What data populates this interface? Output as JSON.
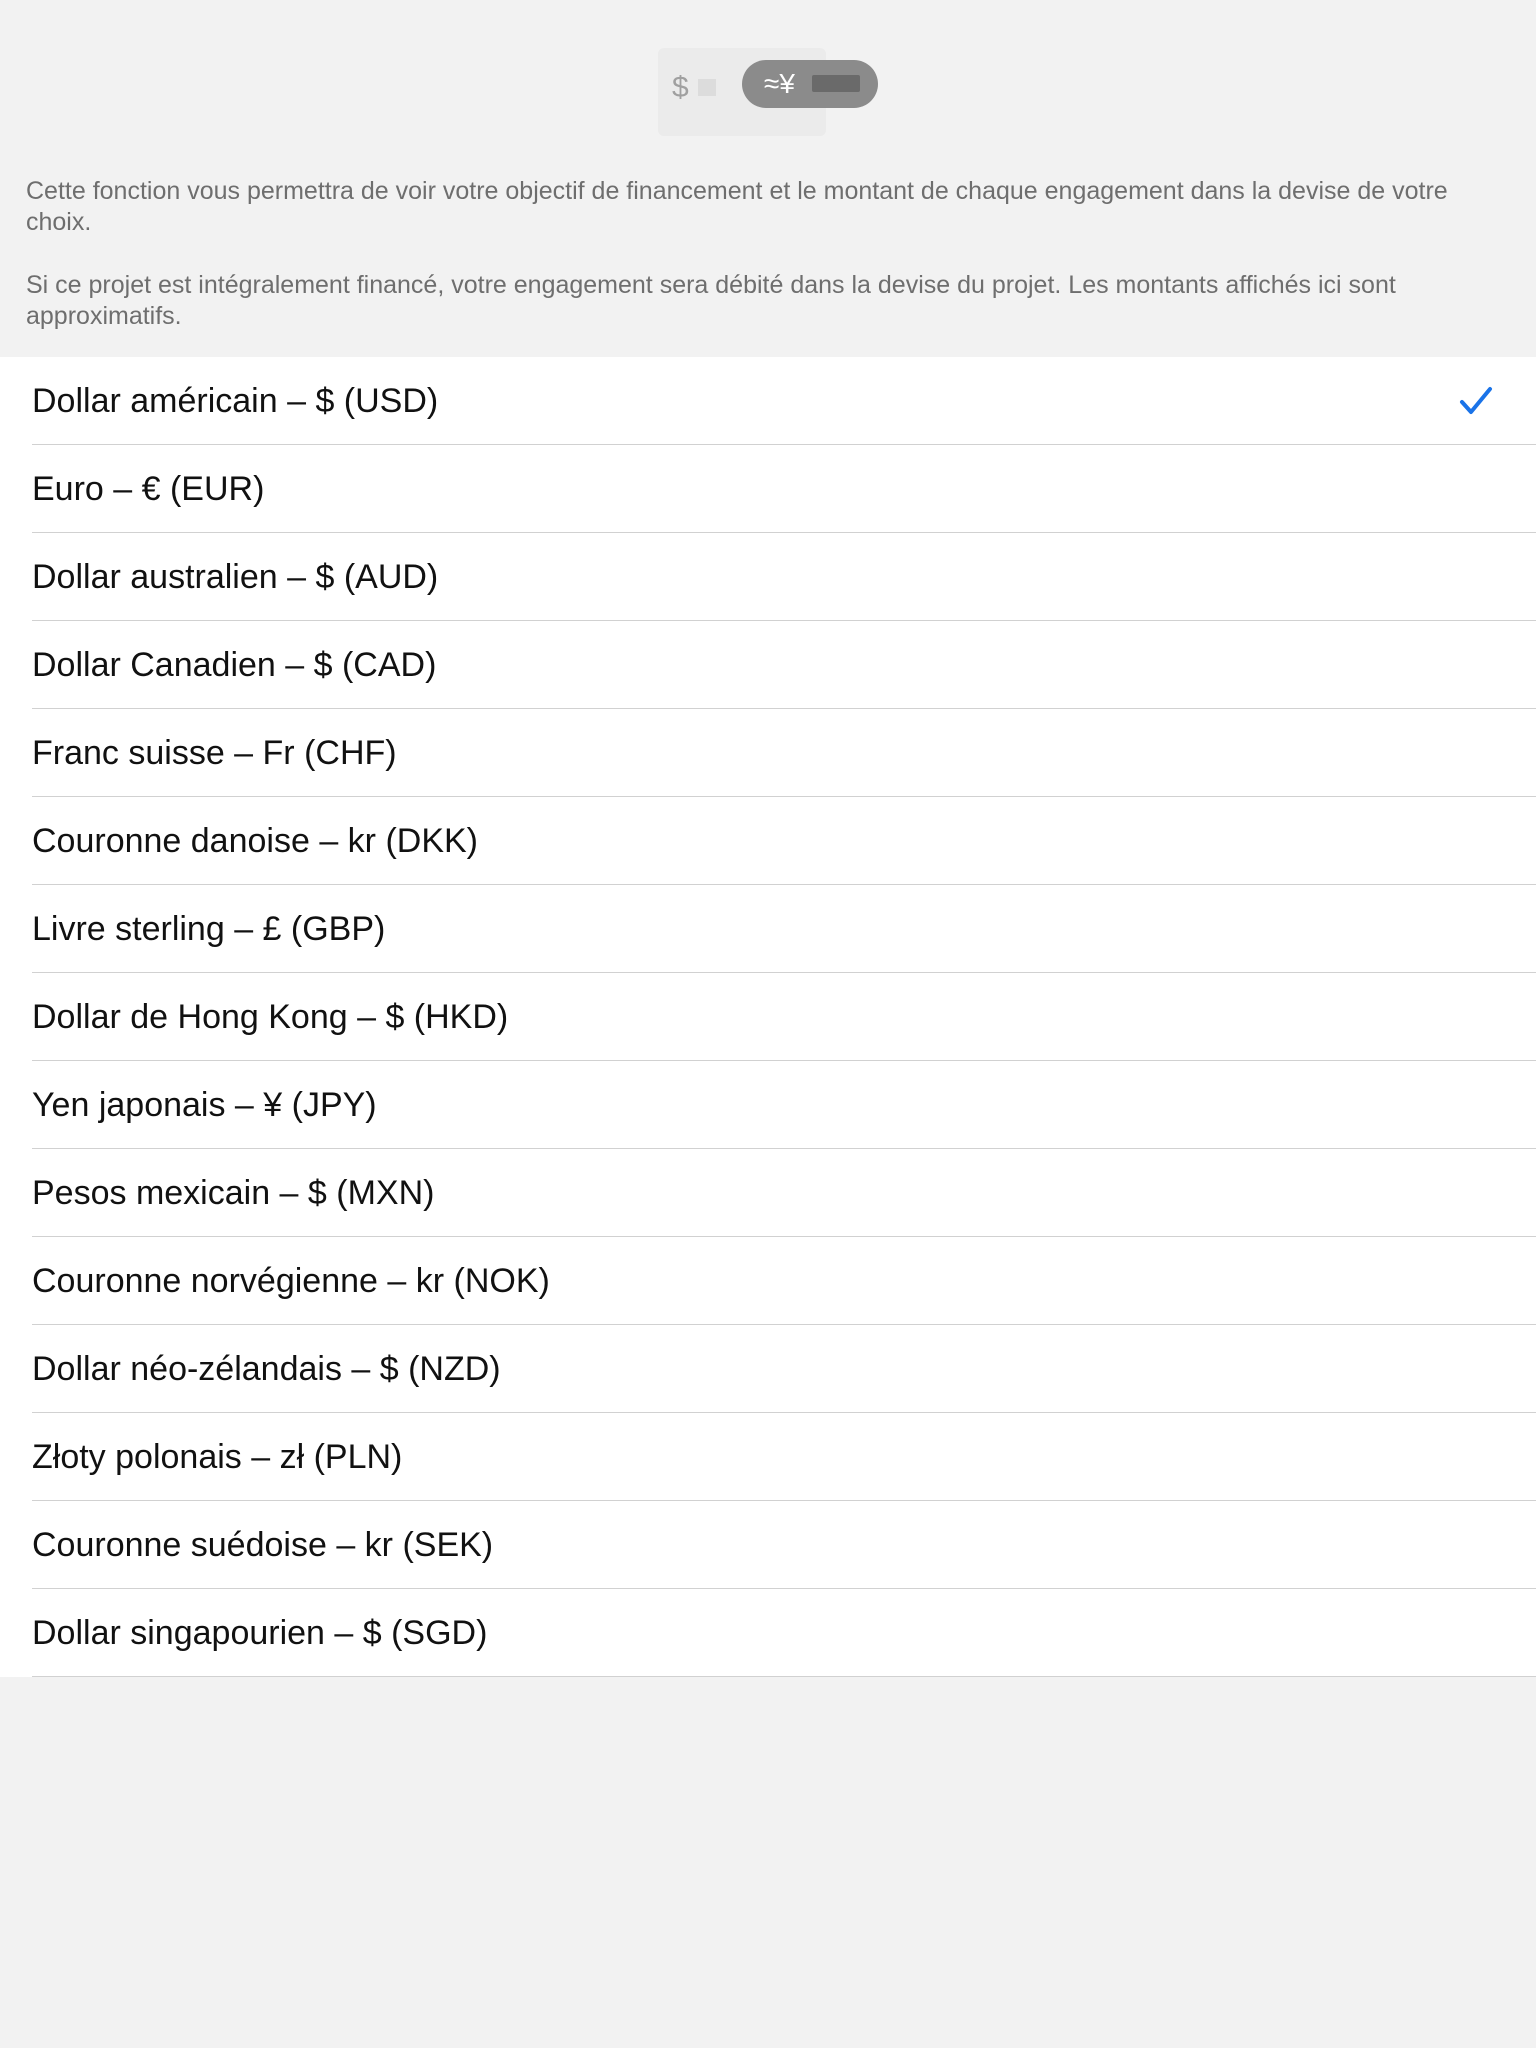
{
  "header": {
    "illustration": {
      "left_symbol": "$",
      "right_symbol": "≈¥",
      "pill_color": "#8b8b8b"
    },
    "description": [
      "Cette fonction vous permettra de voir votre objectif de financement et le montant de chaque engagement dans la devise de votre choix.",
      "Si ce projet est intégralement financé, votre engagement sera débité dans la devise du projet. Les montants affichés ici sont approximatifs."
    ]
  },
  "currencies": [
    {
      "label": "Dollar américain – $ (USD)",
      "selected": true
    },
    {
      "label": "Euro – € (EUR)",
      "selected": false
    },
    {
      "label": "Dollar australien – $ (AUD)",
      "selected": false
    },
    {
      "label": "Dollar Canadien – $ (CAD)",
      "selected": false
    },
    {
      "label": "Franc suisse – Fr (CHF)",
      "selected": false
    },
    {
      "label": "Couronne danoise – kr (DKK)",
      "selected": false
    },
    {
      "label": "Livre sterling – £ (GBP)",
      "selected": false
    },
    {
      "label": "Dollar de Hong Kong – $ (HKD)",
      "selected": false
    },
    {
      "label": "Yen japonais – ¥ (JPY)",
      "selected": false
    },
    {
      "label": "Pesos mexicain – $ (MXN)",
      "selected": false
    },
    {
      "label": "Couronne norvégienne – kr (NOK)",
      "selected": false
    },
    {
      "label": "Dollar néo-zélandais – $ (NZD)",
      "selected": false
    },
    {
      "label": "Złoty polonais – zł (PLN)",
      "selected": false
    },
    {
      "label": "Couronne suédoise – kr (SEK)",
      "selected": false
    },
    {
      "label": "Dollar singapourien – $ (SGD)",
      "selected": false
    }
  ],
  "selection_icon": "checkmark-icon",
  "colors": {
    "accent": "#1a73e8",
    "background": "#f2f2f2",
    "list_background": "#ffffff",
    "separator": "#d1d1d1",
    "secondary_text": "#6e6e6e"
  }
}
